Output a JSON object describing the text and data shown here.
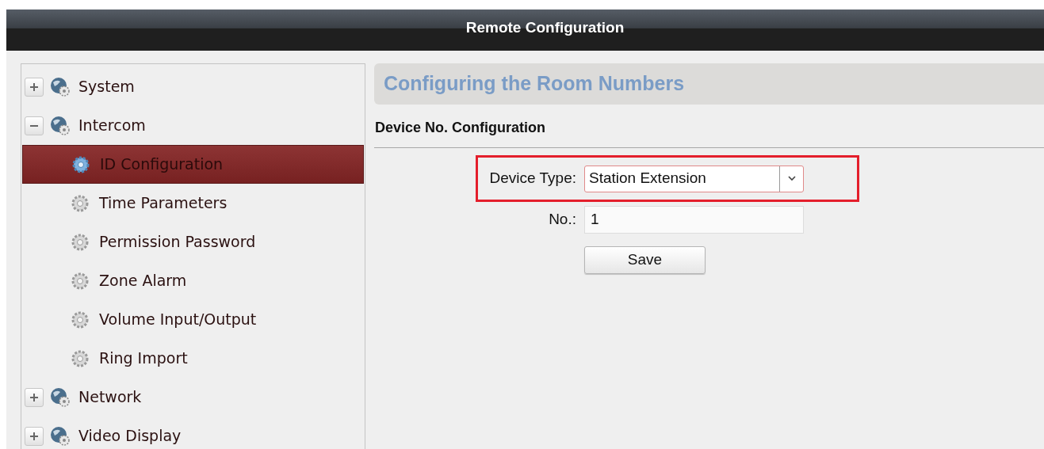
{
  "window": {
    "title": "Remote Configuration"
  },
  "sidebar": {
    "items": [
      {
        "label": "System",
        "expanded": false
      },
      {
        "label": "Intercom",
        "expanded": true,
        "children": [
          {
            "label": "ID Configuration",
            "selected": true
          },
          {
            "label": "Time Parameters",
            "selected": false
          },
          {
            "label": "Permission Password",
            "selected": false
          },
          {
            "label": "Zone Alarm",
            "selected": false
          },
          {
            "label": "Volume Input/Output",
            "selected": false
          },
          {
            "label": "Ring Import",
            "selected": false
          }
        ]
      },
      {
        "label": "Network",
        "expanded": false
      },
      {
        "label": "Video Display",
        "expanded": false
      }
    ]
  },
  "content": {
    "title": "Configuring the Room Numbers",
    "section": "Device No. Configuration",
    "device_type": {
      "label": "Device Type:",
      "value": "Station Extension",
      "highlighted": true
    },
    "number": {
      "label": "No.:",
      "value": "1"
    },
    "save_button": "Save"
  }
}
